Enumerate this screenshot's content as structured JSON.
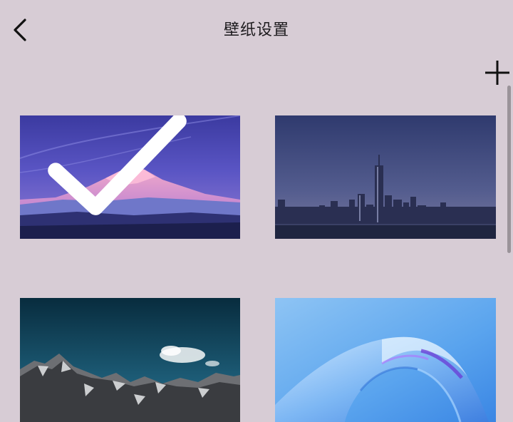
{
  "header": {
    "title": "壁纸设置",
    "back_icon": "chevron-left-icon",
    "add_icon": "plus-icon"
  },
  "wallpapers": [
    {
      "name": "mountain-sunset",
      "selected": true
    },
    {
      "name": "city-skyline",
      "selected": false
    },
    {
      "name": "rocky-peaks",
      "selected": false
    },
    {
      "name": "blue-glass-abstract",
      "selected": false
    }
  ],
  "colors": {
    "background": "#d7ccd5",
    "text": "#1d1b1e",
    "check": "#ffffff"
  }
}
